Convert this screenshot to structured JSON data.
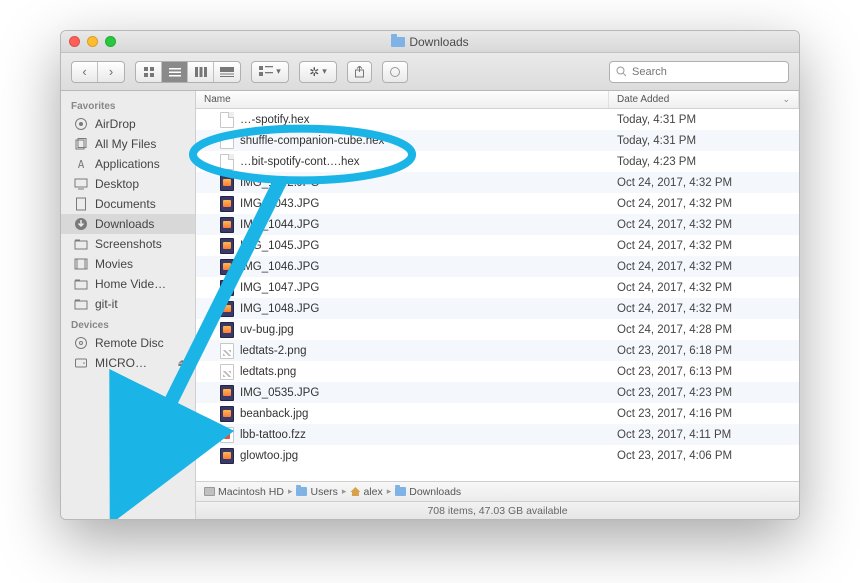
{
  "window": {
    "title": "Downloads"
  },
  "toolbar": {
    "search_placeholder": "Search"
  },
  "sidebar": {
    "sections": [
      {
        "title": "Favorites",
        "items": [
          {
            "label": "AirDrop",
            "icon": "airdrop-icon"
          },
          {
            "label": "All My Files",
            "icon": "all-files-icon"
          },
          {
            "label": "Applications",
            "icon": "applications-icon"
          },
          {
            "label": "Desktop",
            "icon": "desktop-icon"
          },
          {
            "label": "Documents",
            "icon": "documents-icon"
          },
          {
            "label": "Downloads",
            "icon": "downloads-icon",
            "selected": true
          },
          {
            "label": "Screenshots",
            "icon": "folder-icon"
          },
          {
            "label": "Movies",
            "icon": "movies-icon"
          },
          {
            "label": "Home Vide…",
            "icon": "folder-icon"
          },
          {
            "label": "git-it",
            "icon": "folder-icon"
          }
        ]
      },
      {
        "title": "Devices",
        "items": [
          {
            "label": "Remote Disc",
            "icon": "remote-disc-icon"
          },
          {
            "label": "MICRO…",
            "icon": "drive-icon",
            "eject": true
          }
        ]
      }
    ]
  },
  "list": {
    "columns": {
      "name": "Name",
      "date": "Date Added"
    },
    "rows": [
      {
        "name": "…-spotify.hex",
        "icon": "doc",
        "date": "Today, 4:31 PM"
      },
      {
        "name": "shuffle-companion-cube.hex",
        "icon": "doc",
        "date": "Today, 4:31 PM"
      },
      {
        "name": "…bit-spotify-cont….hex",
        "icon": "doc",
        "date": "Today, 4:23 PM"
      },
      {
        "name": "IMG_1042.JPG",
        "icon": "jpg",
        "date": "Oct 24, 2017, 4:32 PM"
      },
      {
        "name": "IMG_1043.JPG",
        "icon": "jpg",
        "date": "Oct 24, 2017, 4:32 PM"
      },
      {
        "name": "IMG_1044.JPG",
        "icon": "jpg",
        "date": "Oct 24, 2017, 4:32 PM"
      },
      {
        "name": "IMG_1045.JPG",
        "icon": "jpg",
        "date": "Oct 24, 2017, 4:32 PM"
      },
      {
        "name": "IMG_1046.JPG",
        "icon": "jpg",
        "date": "Oct 24, 2017, 4:32 PM"
      },
      {
        "name": "IMG_1047.JPG",
        "icon": "jpg",
        "date": "Oct 24, 2017, 4:32 PM"
      },
      {
        "name": "IMG_1048.JPG",
        "icon": "jpg",
        "date": "Oct 24, 2017, 4:32 PM"
      },
      {
        "name": "uv-bug.jpg",
        "icon": "jpg",
        "date": "Oct 24, 2017, 4:28 PM"
      },
      {
        "name": "ledtats-2.png",
        "icon": "png",
        "date": "Oct 23, 2017, 6:18 PM"
      },
      {
        "name": "ledtats.png",
        "icon": "png",
        "date": "Oct 23, 2017, 6:13 PM"
      },
      {
        "name": "IMG_0535.JPG",
        "icon": "jpg",
        "date": "Oct 23, 2017, 4:23 PM"
      },
      {
        "name": "beanback.jpg",
        "icon": "jpg",
        "date": "Oct 23, 2017, 4:16 PM"
      },
      {
        "name": "lbb-tattoo.fzz",
        "icon": "fzz",
        "date": "Oct 23, 2017, 4:11 PM"
      },
      {
        "name": "glowtoo.jpg",
        "icon": "jpg",
        "date": "Oct 23, 2017, 4:06 PM"
      }
    ]
  },
  "pathbar": {
    "items": [
      {
        "label": "Macintosh HD",
        "icon": "hd"
      },
      {
        "label": "Users",
        "icon": "folder"
      },
      {
        "label": "alex",
        "icon": "home"
      },
      {
        "label": "Downloads",
        "icon": "folder"
      }
    ]
  },
  "status": {
    "text": "708 items, 47.03 GB available"
  },
  "annotation": {
    "color": "#1ab4e6"
  }
}
